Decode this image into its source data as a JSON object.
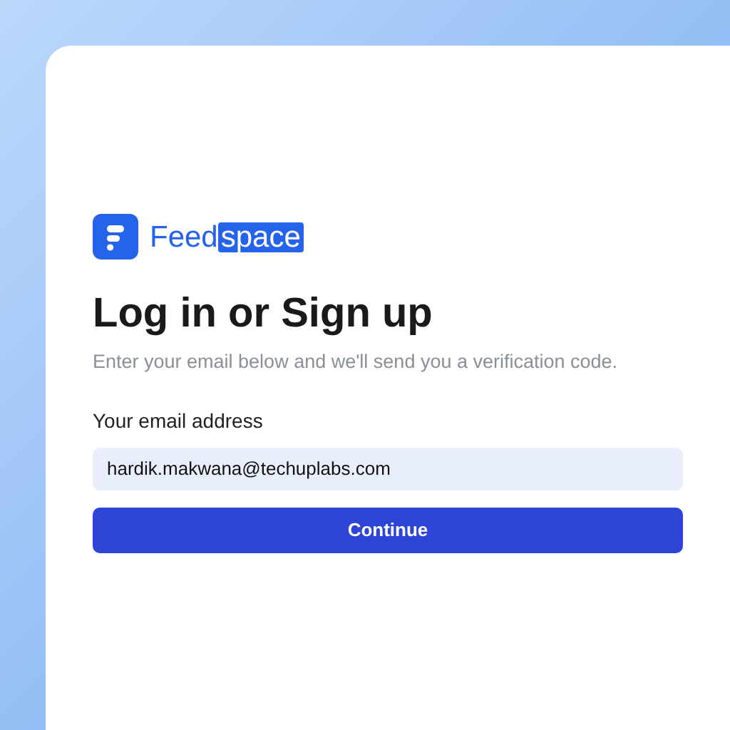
{
  "logo": {
    "text": "Feed",
    "highlight": "space"
  },
  "heading": "Log in or Sign up",
  "subtitle": "Enter your email below and we'll send you a verification code.",
  "email": {
    "label": "Your email address",
    "value": "hardik.makwana@techuplabs.com"
  },
  "button": "Continue"
}
